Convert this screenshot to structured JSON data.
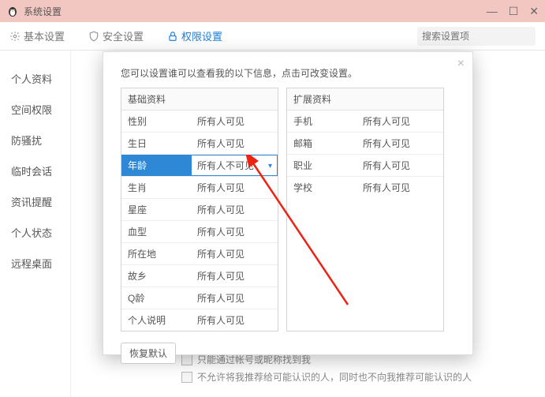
{
  "window": {
    "title": "系统设置"
  },
  "toolbar": {
    "tabs": [
      {
        "label": "基本设置"
      },
      {
        "label": "安全设置"
      },
      {
        "label": "权限设置"
      }
    ],
    "search_placeholder": "搜索设置项"
  },
  "sidebar": {
    "items": [
      "个人资料",
      "空间权限",
      "防骚扰",
      "临时会话",
      "资讯提醒",
      "个人状态",
      "远程桌面"
    ]
  },
  "modal": {
    "intro": "您可以设置谁可以查看我的以下信息，点击可改变设置。",
    "left_header": "基础资料",
    "right_header": "扩展资料",
    "left_rows": [
      {
        "k": "性别",
        "v": "所有人可见"
      },
      {
        "k": "生日",
        "v": "所有人可见"
      },
      {
        "k": "年龄",
        "v": "所有人不可见",
        "selected": true
      },
      {
        "k": "生肖",
        "v": "所有人可见"
      },
      {
        "k": "星座",
        "v": "所有人可见"
      },
      {
        "k": "血型",
        "v": "所有人可见"
      },
      {
        "k": "所在地",
        "v": "所有人可见"
      },
      {
        "k": "故乡",
        "v": "所有人可见"
      },
      {
        "k": "Q龄",
        "v": "所有人可见"
      },
      {
        "k": "个人说明",
        "v": "所有人可见"
      }
    ],
    "right_rows": [
      {
        "k": "手机",
        "v": "所有人可见"
      },
      {
        "k": "邮箱",
        "v": "所有人可见"
      },
      {
        "k": "职业",
        "v": "所有人可见"
      },
      {
        "k": "学校",
        "v": "所有人可见"
      }
    ],
    "restore_label": "恢复默认"
  },
  "hints": {
    "line1": "只能通过帐号或昵称找到我",
    "line2": "不允许将我推荐给可能认识的人，同时也不向我推荐可能认识的人"
  }
}
